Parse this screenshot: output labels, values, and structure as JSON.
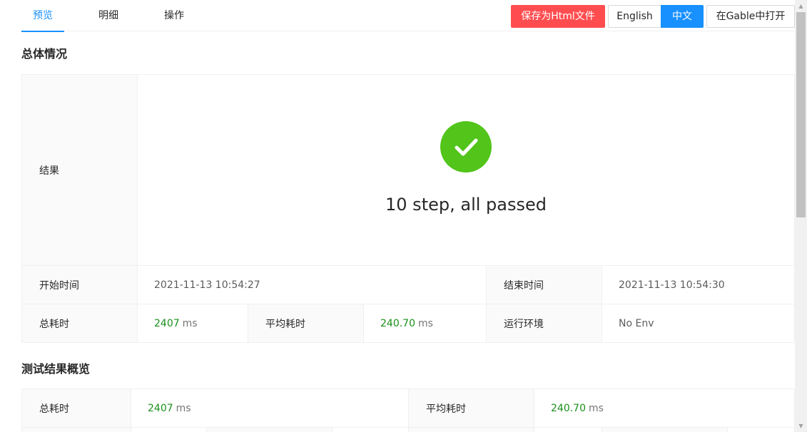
{
  "tabs": [
    {
      "label": "预览",
      "active": true
    },
    {
      "label": "明细",
      "active": false
    },
    {
      "label": "操作",
      "active": false
    }
  ],
  "toolbar": {
    "save_label": "保存为Html文件",
    "english_label": "English",
    "chinese_label": "中文",
    "gable_label": "在Gable中打开",
    "selected_language": "中文"
  },
  "overview": {
    "title": "总体情况",
    "result_label": "结果",
    "result_icon": "check-circle-icon",
    "result_text": "10 step, all passed",
    "start_label": "开始时间",
    "start_value": "2021-11-13 10:54:27",
    "end_label": "结束时间",
    "end_value": "2021-11-13 10:54:30",
    "total_label": "总耗时",
    "total_value": "2407",
    "total_unit": "ms",
    "avg_label": "平均耗时",
    "avg_value": "240.70",
    "avg_unit": "ms",
    "env_label": "运行环境",
    "env_value": "No Env"
  },
  "summary": {
    "title": "测试结果概览",
    "total_label": "总耗时",
    "total_value": "2407",
    "total_unit": "ms",
    "avg_label": "平均耗时",
    "avg_value": "240.70",
    "avg_unit": "ms"
  },
  "colors": {
    "accent": "#1890ff",
    "danger": "#ff4d4f",
    "success": "#52c41a",
    "number": "#1a8f1a"
  }
}
